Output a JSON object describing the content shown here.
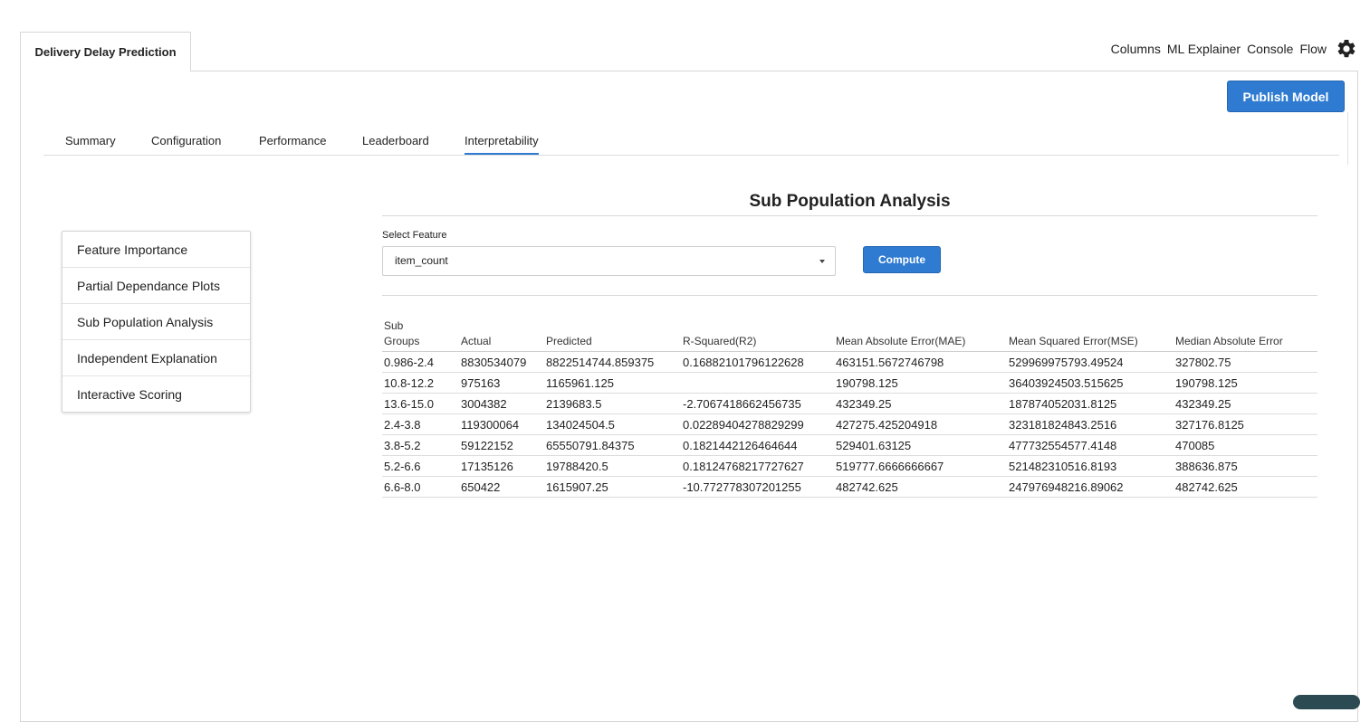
{
  "app": {
    "tab_title": "Delivery Delay Prediction"
  },
  "top_nav": {
    "items": [
      "Columns",
      "ML Explainer",
      "Console",
      "Flow"
    ],
    "settings_icon": "gear-icon"
  },
  "actions": {
    "publish_label": "Publish Model"
  },
  "subtabs": [
    "Summary",
    "Configuration",
    "Performance",
    "Leaderboard",
    "Interpretability"
  ],
  "active_subtab": "Interpretability",
  "side_menu": [
    "Feature Importance",
    "Partial Dependance Plots",
    "Sub Population Analysis",
    "Independent Explanation",
    "Interactive Scoring"
  ],
  "analysis": {
    "title": "Sub Population Analysis",
    "select_label": "Select Feature",
    "select_value": "item_count",
    "compute_label": "Compute"
  },
  "table": {
    "headers": [
      "Sub\nGroups",
      "Actual",
      "Predicted",
      "R-Squared(R2)",
      "Mean Absolute Error(MAE)",
      "Mean Squared Error(MSE)",
      "Median Absolute Error"
    ],
    "rows": [
      [
        "0.986-2.4",
        "8830534079",
        "8822514744.859375",
        "0.16882101796122628",
        "463151.5672746798",
        "529969975793.49524",
        "327802.75"
      ],
      [
        "10.8-12.2",
        "975163",
        "1165961.125",
        "",
        "190798.125",
        "36403924503.515625",
        "190798.125"
      ],
      [
        "13.6-15.0",
        "3004382",
        "2139683.5",
        "-2.7067418662456735",
        "432349.25",
        "187874052031.8125",
        "432349.25"
      ],
      [
        "2.4-3.8",
        "119300064",
        "134024504.5",
        "0.02289404278829299",
        "427275.425204918",
        "323181824843.2516",
        "327176.8125"
      ],
      [
        "3.8-5.2",
        "59122152",
        "65550791.84375",
        "0.1821442126464644",
        "529401.63125",
        "477732554577.4148",
        "470085"
      ],
      [
        "5.2-6.6",
        "17135126",
        "19788420.5",
        "0.18124768217727627",
        "519777.6666666667",
        "521482310516.8193",
        "388636.875"
      ],
      [
        "6.6-8.0",
        "650422",
        "1615907.25",
        "-10.772778307201255",
        "482742.625",
        "247976948216.89062",
        "482742.625"
      ]
    ]
  },
  "colors": {
    "primary": "#2f7bd1",
    "border": "#d6d6d6"
  }
}
